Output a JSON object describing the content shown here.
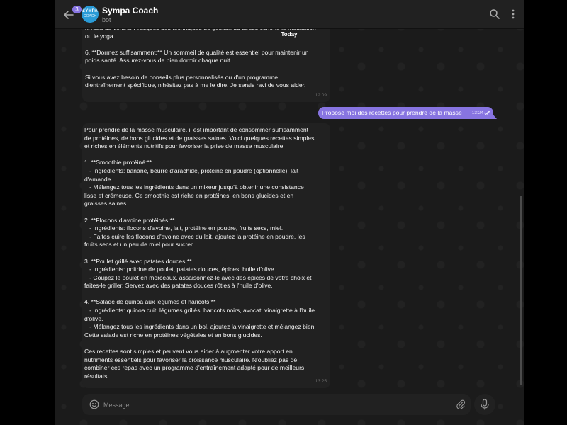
{
  "header": {
    "unread_badge": "3",
    "avatar_logo_line1": "SYMPA",
    "avatar_logo_line2": "COACH",
    "title": "Sympa Coach",
    "subtitle": "bot"
  },
  "chat": {
    "date_separator": "Today",
    "messages": [
      {
        "direction": "incoming",
        "text": "niveau du ventre. Pratiquez des techniques de gestion du stress comme la méditation\nou le yoga.\n\n6. **Dormez suffisamment:** Un sommeil de qualité est essentiel pour maintenir un\npoids santé. Assurez-vous de bien dormir chaque nuit.\n\nSi vous avez besoin de conseils plus personnalisés ou d'un programme\nd'entraînement spécifique, n'hésitez pas à me le dire. Je serais ravi de vous aider.",
        "time": "12:09"
      },
      {
        "direction": "outgoing",
        "text": "Propose moi des recettes pour prendre de la masse",
        "time": "13:24",
        "status": "read"
      },
      {
        "direction": "incoming",
        "text": "Pour prendre de la masse musculaire, il est important de consommer suffisamment\nde protéines, de bons glucides et de graisses saines. Voici quelques recettes simples\net riches en éléments nutritifs pour favoriser la prise de masse musculaire:\n\n1. **Smoothie protéiné:**\n   - Ingrédients: banane, beurre d'arachide, protéine en poudre (optionnelle), lait\nd'amande.\n   - Mélangez tous les ingrédients dans un mixeur jusqu'à obtenir une consistance\nlisse et crémeuse. Ce smoothie est riche en protéines, en bons glucides et en\ngraisses saines.\n\n2. **Flocons d'avoine protéinés:**\n   - Ingrédients: flocons d'avoine, lait, protéine en poudre, fruits secs, miel.\n   - Faites cuire les flocons d'avoine avec du lait, ajoutez la protéine en poudre, les\nfruits secs et un peu de miel pour sucrer.\n\n3. **Poulet grillé avec patates douces:**\n   - Ingrédients: poitrine de poulet, patates douces, épices, huile d'olive.\n   - Coupez le poulet en morceaux, assaisonnez-le avec des épices de votre choix et\nfaites-le griller. Servez avec des patates douces rôties à l'huile d'olive.\n\n4. **Salade de quinoa aux légumes et haricots:**\n   - Ingrédients: quinoa cuit, légumes grillés, haricots noirs, avocat, vinaigrette à l'huile\nd'olive.\n   - Mélangez tous les ingrédients dans un bol, ajoutez la vinaigrette et mélangez bien.\nCette salade est riche en protéines végétales et en bons glucides.\n\nCes recettes sont simples et peuvent vous aider à augmenter votre apport en\nnutriments essentiels pour favoriser la croissance musculaire. N'oubliez pas de\ncombiner ces repas avec un programme d'entraînement adapté pour de meilleurs\nrésultats.",
        "time": "13:25"
      }
    ]
  },
  "composer": {
    "placeholder": "Message"
  },
  "colors": {
    "accent": "#8774e1",
    "bubble_incoming": "#212121",
    "background": "#1b1b1b"
  },
  "icons": [
    "back-arrow-icon",
    "search-icon",
    "more-vertical-icon",
    "double-check-icon",
    "emoji-icon",
    "paperclip-icon",
    "microphone-icon"
  ]
}
